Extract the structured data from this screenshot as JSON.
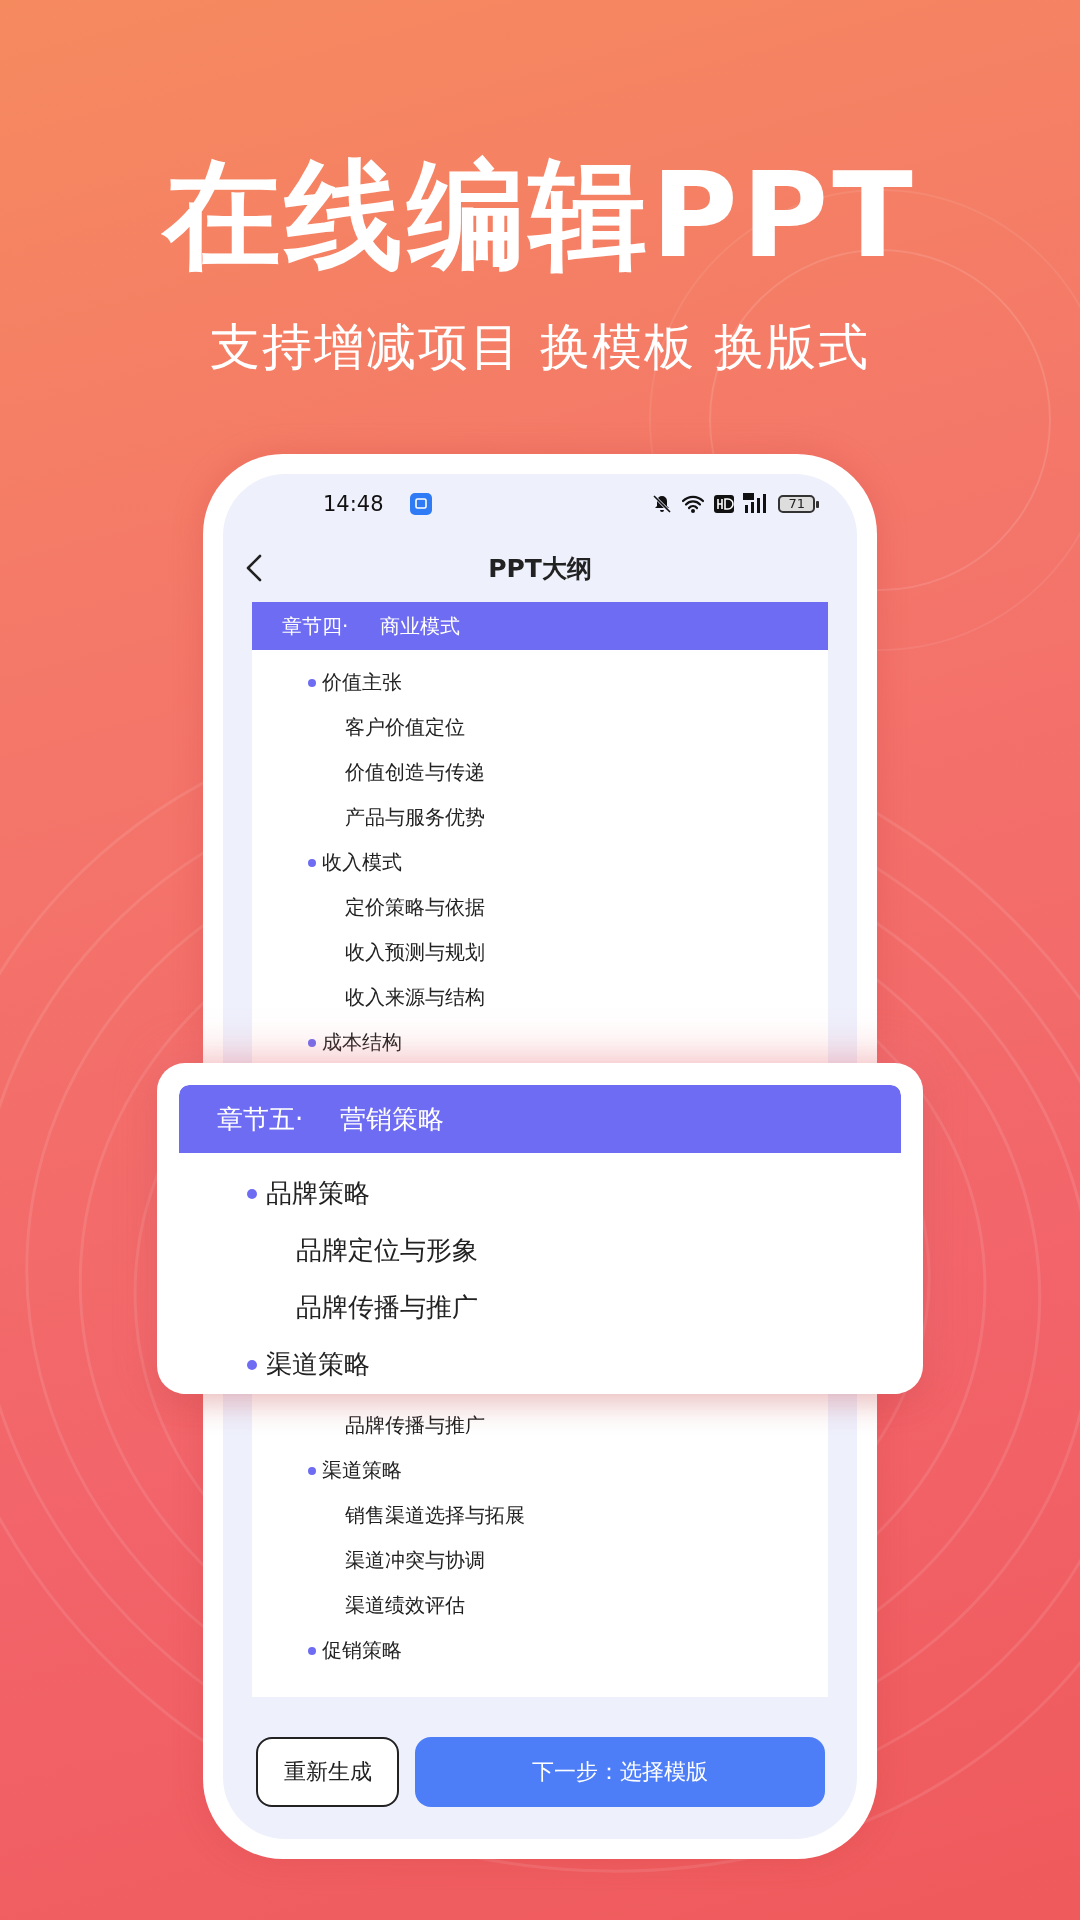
{
  "headline": "在线编辑PPT",
  "subheadline": "支持增减项目 换模板 换版式",
  "phone": {
    "status_bar": {
      "time": "14:48",
      "battery": "71"
    },
    "nav": {
      "title": "PPT大纲"
    },
    "outline": {
      "chapter": {
        "number": "章节四·",
        "title": "商业模式"
      },
      "items": [
        {
          "kind": "topic",
          "text": "价值主张",
          "children": [
            {
              "kind": "sub",
              "text": "客户价值定位"
            },
            {
              "kind": "sub",
              "text": "价值创造与传递"
            },
            {
              "kind": "sub",
              "text": "产品与服务优势"
            }
          ]
        },
        {
          "kind": "topic",
          "text": "收入模式",
          "children": [
            {
              "kind": "sub",
              "text": "定价策略与依据"
            },
            {
              "kind": "sub",
              "text": "收入预测与规划"
            },
            {
              "kind": "sub",
              "text": "收入来源与结构"
            }
          ]
        },
        {
          "kind": "topic",
          "text": "成本结构"
        }
      ],
      "lower_items": [
        {
          "kind": "sub",
          "text": "品牌传播与推广"
        },
        {
          "kind": "topic",
          "text": "渠道策略",
          "children": [
            {
              "kind": "sub",
              "text": "销售渠道选择与拓展"
            },
            {
              "kind": "sub",
              "text": "渠道冲突与协调"
            },
            {
              "kind": "sub",
              "text": "渠道绩效评估"
            }
          ]
        },
        {
          "kind": "topic",
          "text": "促销策略"
        }
      ]
    },
    "buttons": [
      {
        "kind": "outline",
        "label": "重新生成"
      },
      {
        "kind": "primary",
        "label": "下一步：选择模版"
      }
    ]
  },
  "popup": {
    "chapter": {
      "number": "章节五·",
      "title": "营销策略"
    },
    "items": [
      {
        "kind": "topic",
        "text": "品牌策略",
        "children": [
          {
            "kind": "sub",
            "text": "品牌定位与形象"
          },
          {
            "kind": "sub",
            "text": "品牌传播与推广"
          }
        ]
      },
      {
        "kind": "topic",
        "text": "渠道策略"
      }
    ]
  }
}
